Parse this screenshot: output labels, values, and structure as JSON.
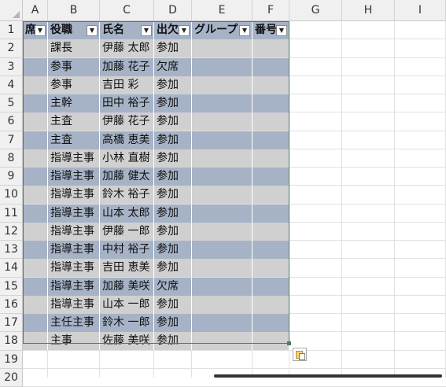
{
  "columns": [
    "A",
    "B",
    "C",
    "D",
    "E",
    "F",
    "G",
    "H",
    "I"
  ],
  "rows": [
    "1",
    "2",
    "3",
    "4",
    "5",
    "6",
    "7",
    "8",
    "9",
    "10",
    "11",
    "12",
    "13",
    "14",
    "15",
    "16",
    "17",
    "18",
    "19",
    "20"
  ],
  "table": {
    "headers": [
      "席",
      "役職",
      "氏名",
      "出欠",
      "グループ",
      "番号"
    ],
    "dropdown_glyph": "▼",
    "records": [
      [
        "",
        "課長",
        "伊藤 太郎",
        "参加",
        "",
        ""
      ],
      [
        "",
        "参事",
        "加藤 花子",
        "欠席",
        "",
        ""
      ],
      [
        "",
        "参事",
        "吉田 彩",
        "参加",
        "",
        ""
      ],
      [
        "",
        "主幹",
        "田中 裕子",
        "参加",
        "",
        ""
      ],
      [
        "",
        "主査",
        "伊藤 花子",
        "参加",
        "",
        ""
      ],
      [
        "",
        "主査",
        "高橋 恵美",
        "参加",
        "",
        ""
      ],
      [
        "",
        "指導主事",
        "小林 直樹",
        "参加",
        "",
        ""
      ],
      [
        "",
        "指導主事",
        "加藤 健太",
        "参加",
        "",
        ""
      ],
      [
        "",
        "指導主事",
        "鈴木 裕子",
        "参加",
        "",
        ""
      ],
      [
        "",
        "指導主事",
        "山本 太郎",
        "参加",
        "",
        ""
      ],
      [
        "",
        "指導主事",
        "伊藤 一郎",
        "参加",
        "",
        ""
      ],
      [
        "",
        "指導主事",
        "中村 裕子",
        "参加",
        "",
        ""
      ],
      [
        "",
        "指導主事",
        "吉田 恵美",
        "参加",
        "",
        ""
      ],
      [
        "",
        "指導主事",
        "加藤 美咲",
        "欠席",
        "",
        ""
      ],
      [
        "",
        "指導主事",
        "山本 一郎",
        "参加",
        "",
        ""
      ],
      [
        "",
        "主任主事",
        "鈴木 一郎",
        "参加",
        "",
        ""
      ],
      [
        "",
        "主事",
        "佐藤 美咲",
        "参加",
        "",
        ""
      ]
    ]
  },
  "colors": {
    "band_dark": "#a6b3c7",
    "band_light": "#d0d0d0",
    "table_border": "#4f7a5e"
  },
  "icons": {
    "paste_options": "paste-options-icon",
    "resize_handle": "table-resize-handle"
  }
}
